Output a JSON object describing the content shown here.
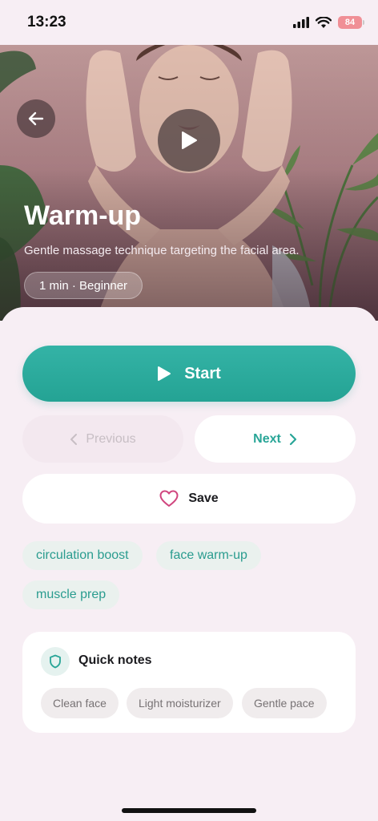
{
  "status_bar": {
    "time": "13:23",
    "battery": "84"
  },
  "hero": {
    "title": "Warm-up",
    "subtitle": "Gentle massage technique targeting the facial area.",
    "badge": "1 min · Beginner"
  },
  "actions": {
    "start_label": "Start",
    "previous_label": "Previous",
    "next_label": "Next",
    "save_label": "Save"
  },
  "tags": [
    "circulation boost",
    "face warm-up",
    "muscle prep"
  ],
  "quick_notes": {
    "title": "Quick notes",
    "items": [
      "Clean face",
      "Light moisturizer",
      "Gentle pace"
    ]
  },
  "colors": {
    "accent": "#28a597",
    "background": "#f7eef4",
    "heart": "#d0457e"
  },
  "icons": {
    "back": "arrow-left-icon",
    "play": "play-icon",
    "previous": "chevron-left-icon",
    "next": "chevron-right-icon",
    "save": "heart-icon",
    "notes": "shield-icon"
  }
}
